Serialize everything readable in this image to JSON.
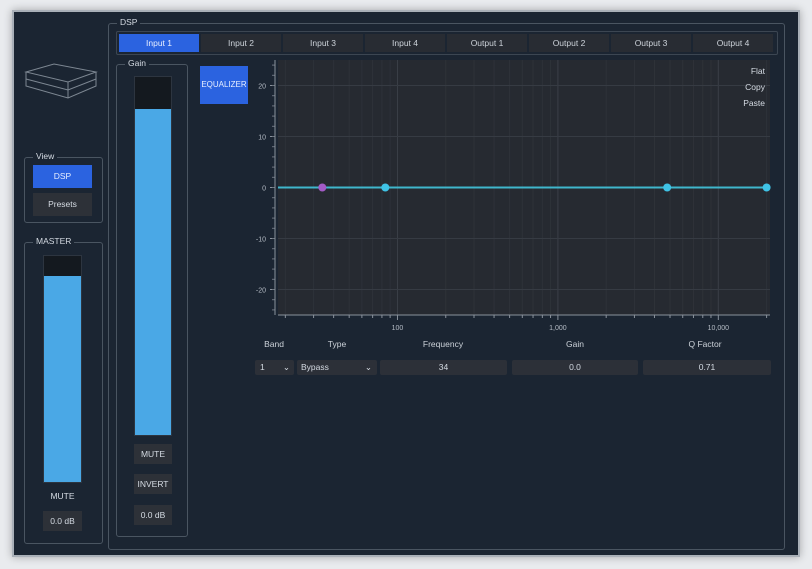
{
  "dsp_group": {
    "label": "DSP",
    "tabs": [
      "Input 1",
      "Input 2",
      "Input 3",
      "Input 4",
      "Output 1",
      "Output 2",
      "Output 3",
      "Output 4"
    ],
    "active_tab": 0
  },
  "view_group": {
    "label": "View",
    "buttons": [
      "DSP",
      "Presets"
    ],
    "active": 0
  },
  "master": {
    "label": "MASTER",
    "level": 0.91,
    "mute": "MUTE",
    "gain_value": "0.0 dB"
  },
  "gain": {
    "label": "Gain",
    "level": 0.91,
    "mute": "MUTE",
    "invert": "INVERT",
    "gain_value": "0.0 dB"
  },
  "equalizer_button": "EQUALIZER",
  "chart_actions": [
    "Flat",
    "Copy",
    "Paste"
  ],
  "chart_data": {
    "type": "line",
    "x_scale": "log",
    "xlim": [
      18,
      21000
    ],
    "ylim": [
      -25,
      25
    ],
    "x_ticks": [
      {
        "v": 100,
        "label": "100"
      },
      {
        "v": 1000,
        "label": "1,000"
      },
      {
        "v": 10000,
        "label": "10,000"
      }
    ],
    "y_ticks": [
      {
        "v": 20,
        "label": "20"
      },
      {
        "v": 10,
        "label": "10"
      },
      {
        "v": 0,
        "label": "0"
      },
      {
        "v": -10,
        "label": "-10"
      },
      {
        "v": -20,
        "label": "-20"
      }
    ],
    "curve": [
      [
        18,
        0
      ],
      [
        21000,
        0
      ]
    ],
    "points": [
      {
        "x": 34,
        "y": 0,
        "selected": true
      },
      {
        "x": 84,
        "y": 0
      },
      {
        "x": 4800,
        "y": 0
      },
      {
        "x": 20000,
        "y": 0
      }
    ],
    "colors": {
      "curve": "#3fb6cc",
      "point": "#3fc3e6",
      "selected": "#a35bc7"
    }
  },
  "band_table": {
    "headers": [
      "Band",
      "Type",
      "Frequency",
      "Gain",
      "Q Factor"
    ],
    "band": "1",
    "type": "Bypass",
    "frequency": "34",
    "gain": "0.0",
    "q_factor": "0.71"
  }
}
